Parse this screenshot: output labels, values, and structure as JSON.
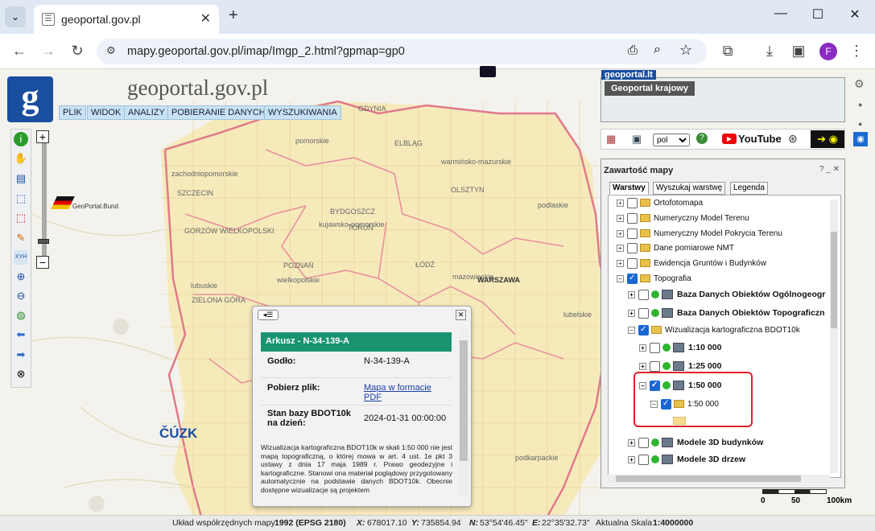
{
  "browser": {
    "tab_title": "geoportal.gov.pl",
    "url": "mapy.geoportal.gov.pl/imap/Imgp_2.html?gpmap=gp0",
    "profile_initial": "F",
    "new_tab": "+",
    "tab_close": "✕",
    "win_min": "—",
    "win_max": "☐",
    "win_close": "✕"
  },
  "header": {
    "logo_letter": "g",
    "title": "geoportal.gov.pl",
    "menu": [
      "PLIK",
      "WIDOK",
      "ANALIZY",
      "POBIERANIE DANYCH",
      "WYSZUKIWANIA"
    ]
  },
  "map_labels": {
    "geoportal_bund": "GeoPortal.Bund",
    "cuzk": "ČÚZK",
    "regions": [
      "pomorskie",
      "zachodniopomorskie",
      "warmińsko-mazurskie",
      "podlaskie",
      "kujawsko-pomorskie",
      "WARSZAWA",
      "mazowieckie",
      "lubuskie",
      "wielkopolskie",
      "POZNAŃ",
      "SZCZECIN",
      "GDYNIA",
      "OLSZTYN",
      "BYDGOSZCZ",
      "TORUŃ",
      "ŁÓDŹ",
      "ZIELONA GÓRA",
      "lubelskie",
      "podkarpackie",
      "GORZÓW WIELKOPOLSKI",
      "ELBLĄG"
    ]
  },
  "minimap": {
    "label": "Geoportal krajowy",
    "brand": "geoportal.lt"
  },
  "tools_row": {
    "language": "pol",
    "youtube": "YouTube"
  },
  "panel": {
    "title": "Zawartość mapy",
    "controls": "? _ ✕",
    "tabs": [
      "Warstwy",
      "Wyszukaj warstwę",
      "Legenda"
    ],
    "layers": [
      {
        "label": "Ortofotomapa",
        "bold": false,
        "checked": false,
        "indent": 0,
        "type": "folder"
      },
      {
        "label": "Numeryczny Model Terenu",
        "bold": false,
        "checked": false,
        "indent": 0,
        "type": "folder"
      },
      {
        "label": "Numeryczny Model Pokrycia Terenu",
        "bold": false,
        "checked": false,
        "indent": 0,
        "type": "folder"
      },
      {
        "label": "Dane pomiarowe NMT",
        "bold": false,
        "checked": false,
        "indent": 0,
        "type": "folder"
      },
      {
        "label": "Ewidencja Gruntów i Budynków",
        "bold": false,
        "checked": false,
        "indent": 0,
        "type": "folder"
      },
      {
        "label": "Topografia",
        "bold": false,
        "checked": true,
        "indent": 0,
        "type": "folder"
      },
      {
        "label": "Baza Danych Obiektów Ogólnogeogr",
        "bold": true,
        "checked": false,
        "indent": 1,
        "type": "wms"
      },
      {
        "label": "Baza Danych Obiektów Topograficzn",
        "bold": true,
        "checked": false,
        "indent": 1,
        "type": "wms"
      },
      {
        "label": "Wizualizacja kartograficzna BDOT10k",
        "bold": false,
        "checked": true,
        "indent": 1,
        "type": "folder"
      },
      {
        "label": "1:10 000",
        "bold": true,
        "checked": false,
        "indent": 2,
        "type": "wms"
      },
      {
        "label": "1:25 000",
        "bold": true,
        "checked": false,
        "indent": 2,
        "type": "wms"
      },
      {
        "label": "1:50 000",
        "bold": true,
        "checked": true,
        "indent": 2,
        "type": "wms"
      },
      {
        "label": "1:50 000",
        "bold": false,
        "checked": true,
        "indent": 3,
        "type": "folder"
      },
      {
        "label": "",
        "bold": false,
        "checked": false,
        "indent": 3,
        "type": "swatch"
      },
      {
        "label": "Modele 3D budynków",
        "bold": true,
        "checked": false,
        "indent": 1,
        "type": "wms"
      },
      {
        "label": "Modele 3D drzew",
        "bold": true,
        "checked": false,
        "indent": 1,
        "type": "wms"
      }
    ]
  },
  "popup": {
    "heading": "Arkusz - N-34-139-A",
    "godlo_label": "Godło:",
    "godlo_value": "N-34-139-A",
    "download_label": "Pobierz plik:",
    "download_link": "Mapa w formacie PDF",
    "date_label": "Stan bazy BDOT10k na dzień:",
    "date_value": "2024-01-31 00:00:00",
    "description": "Wizualizacja kartograficzna BDOT10k w skali 1:50 000 nie jest mapą topograficzną, o której mowa w art. 4 ust. 1e pkt 3 ustawy z dnia 17 maja 1989 r. Prawo geodezyjne i kartograficzne. Stanowi ona materiał poglądowy przygotowany automatycznie na podstawie danych BDOT10k. Obecnie dostępne wizualizacje są projektem"
  },
  "scale_bar": [
    "0",
    "50",
    "100km"
  ],
  "status": {
    "crs_label": "Układ współrzędnych mapy",
    "crs_value": "1992 (EPSG 2180)",
    "x_label": "X:",
    "x_value": "678017.10",
    "y_label": "Y:",
    "y_value": "735854.94",
    "n_label": "N:",
    "n_value": "53°54'46.45\"",
    "e_label": "E:",
    "e_value": "22°35'32.73\"",
    "scale_label": "Aktualna Skala",
    "scale_value": "1:4000000"
  }
}
